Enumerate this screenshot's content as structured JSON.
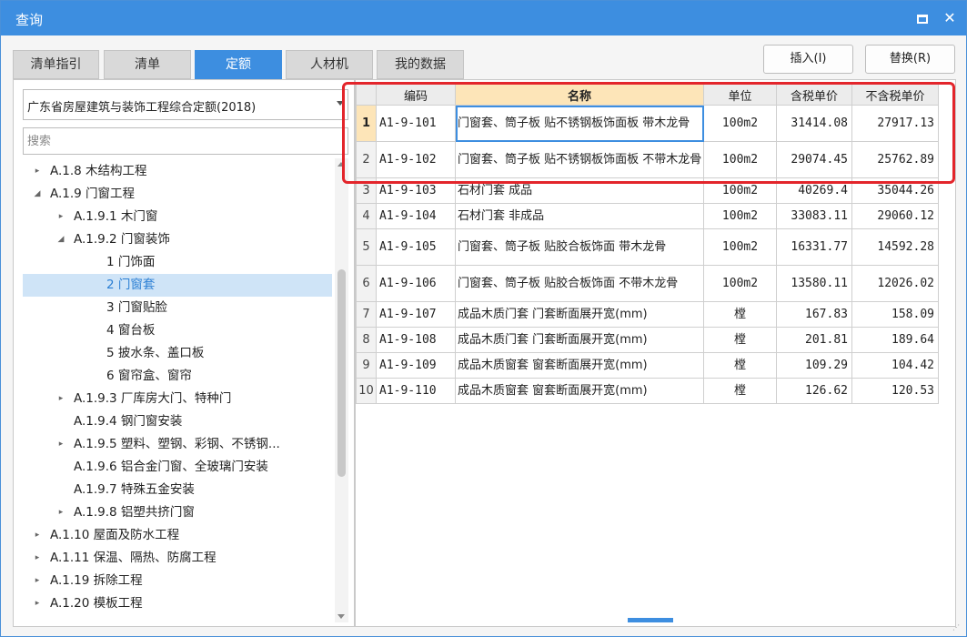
{
  "window": {
    "title": "查询"
  },
  "tabs": [
    "清单指引",
    "清单",
    "定额",
    "人材机",
    "我的数据"
  ],
  "active_tab": "定额",
  "buttons": {
    "insert": "插入(I)",
    "replace": "替换(R)"
  },
  "library": {
    "selected": "广东省房屋建筑与装饰工程综合定额(2018)"
  },
  "search": {
    "placeholder": "搜索"
  },
  "tree": [
    {
      "label": "A.1.8 木结构工程",
      "toggle": "▸",
      "level": 0
    },
    {
      "label": "A.1.9 门窗工程",
      "toggle": "◢",
      "level": 0
    },
    {
      "label": "A.1.9.1 木门窗",
      "toggle": "▸",
      "level": 1
    },
    {
      "label": "A.1.9.2 门窗装饰",
      "toggle": "◢",
      "level": 1
    },
    {
      "label": "1 门饰面",
      "toggle": "",
      "level": 2
    },
    {
      "label": "2 门窗套",
      "toggle": "",
      "level": 2,
      "selected": true
    },
    {
      "label": "3 门窗贴脸",
      "toggle": "",
      "level": 2
    },
    {
      "label": "4 窗台板",
      "toggle": "",
      "level": 2
    },
    {
      "label": "5 披水条、盖口板",
      "toggle": "",
      "level": 2
    },
    {
      "label": "6 窗帘盒、窗帘",
      "toggle": "",
      "level": 2
    },
    {
      "label": "A.1.9.3 厂库房大门、特种门",
      "toggle": "▸",
      "level": 1
    },
    {
      "label": "A.1.9.4 钢门窗安装",
      "toggle": "",
      "level": 1
    },
    {
      "label": "A.1.9.5 塑料、塑钢、彩钢、不锈钢...",
      "toggle": "▸",
      "level": 1
    },
    {
      "label": "A.1.9.6 铝合金门窗、全玻璃门安装",
      "toggle": "",
      "level": 1
    },
    {
      "label": "A.1.9.7 特殊五金安装",
      "toggle": "",
      "level": 1
    },
    {
      "label": "A.1.9.8 铝塑共挤门窗",
      "toggle": "▸",
      "level": 1
    },
    {
      "label": "A.1.10 屋面及防水工程",
      "toggle": "▸",
      "level": 0
    },
    {
      "label": "A.1.11 保温、隔热、防腐工程",
      "toggle": "▸",
      "level": 0
    },
    {
      "label": "A.1.19 拆除工程",
      "toggle": "▸",
      "level": 0
    },
    {
      "label": "A.1.20 模板工程",
      "toggle": "▸",
      "level": 0
    }
  ],
  "table": {
    "columns": [
      "",
      "编码",
      "名称",
      "单位",
      "含税单价",
      "不含税单价"
    ],
    "rows": [
      {
        "no": "1",
        "code": "A1-9-101",
        "name": "门窗套、筒子板 贴不锈钢板饰面板 带木龙骨",
        "unit": "100m2",
        "price_tax": "31414.08",
        "price_notax": "27917.13"
      },
      {
        "no": "2",
        "code": "A1-9-102",
        "name": "门窗套、筒子板 贴不锈钢板饰面板 不带木龙骨",
        "unit": "100m2",
        "price_tax": "29074.45",
        "price_notax": "25762.89"
      },
      {
        "no": "3",
        "code": "A1-9-103",
        "name": "石材门套 成品",
        "unit": "100m2",
        "price_tax": "40269.4",
        "price_notax": "35044.26"
      },
      {
        "no": "4",
        "code": "A1-9-104",
        "name": "石材门套 非成品",
        "unit": "100m2",
        "price_tax": "33083.11",
        "price_notax": "29060.12"
      },
      {
        "no": "5",
        "code": "A1-9-105",
        "name": "门窗套、筒子板 贴胶合板饰面 带木龙骨",
        "unit": "100m2",
        "price_tax": "16331.77",
        "price_notax": "14592.28"
      },
      {
        "no": "6",
        "code": "A1-9-106",
        "name": "门窗套、筒子板 贴胶合板饰面 不带木龙骨",
        "unit": "100m2",
        "price_tax": "13580.11",
        "price_notax": "12026.02"
      },
      {
        "no": "7",
        "code": "A1-9-107",
        "name": "成品木质门套 门套断面展开宽(mm)",
        "unit": "樘",
        "price_tax": "167.83",
        "price_notax": "158.09"
      },
      {
        "no": "8",
        "code": "A1-9-108",
        "name": "成品木质门套 门套断面展开宽(mm)",
        "unit": "樘",
        "price_tax": "201.81",
        "price_notax": "189.64"
      },
      {
        "no": "9",
        "code": "A1-9-109",
        "name": "成品木质窗套 窗套断面展开宽(mm)",
        "unit": "樘",
        "price_tax": "109.29",
        "price_notax": "104.42"
      },
      {
        "no": "10",
        "code": "A1-9-110",
        "name": "成品木质窗套 窗套断面展开宽(mm)",
        "unit": "樘",
        "price_tax": "126.62",
        "price_notax": "120.53"
      }
    ]
  },
  "colors": {
    "accent": "#3d8ee0",
    "highlight": "#e3252b",
    "header_name": "#fde5b8",
    "selected_row": "#cfe4f7"
  }
}
